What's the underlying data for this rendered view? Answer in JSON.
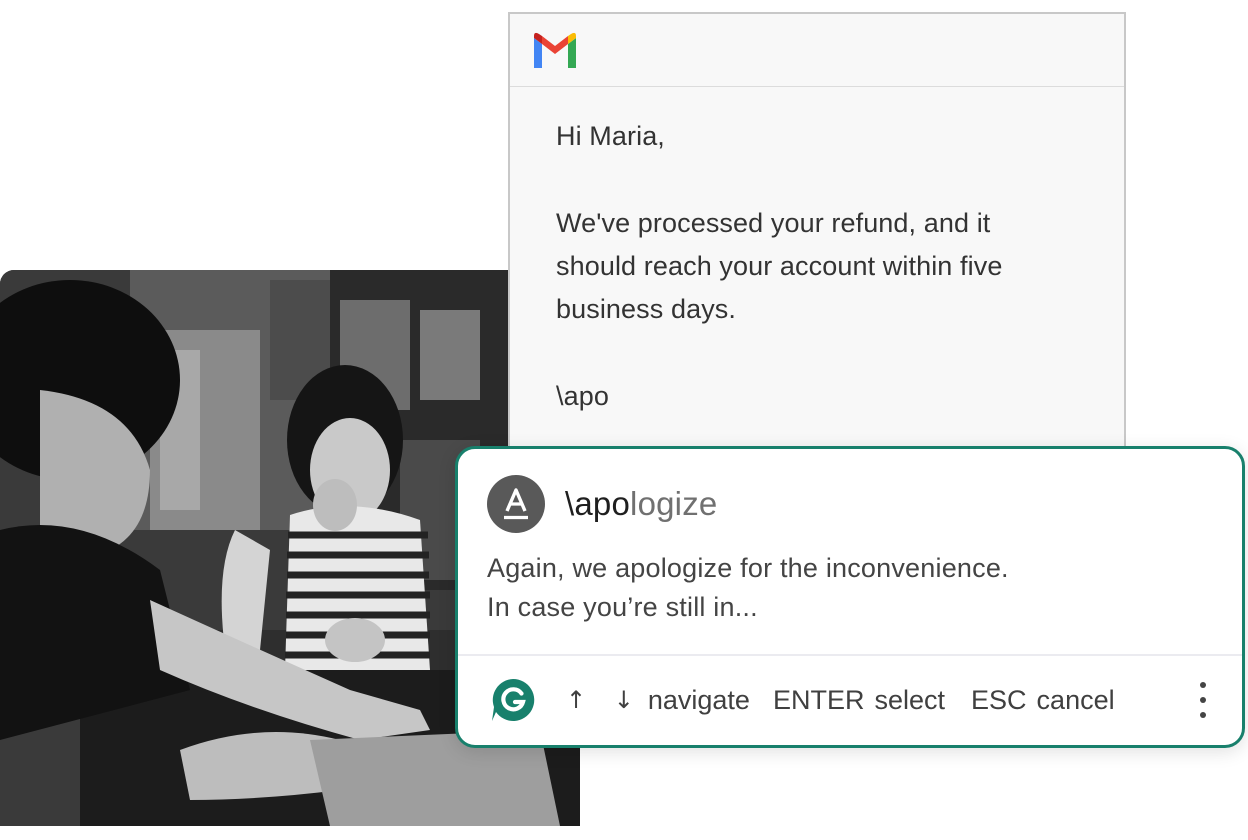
{
  "email": {
    "app_icon": "gmail-icon",
    "greeting": "Hi Maria,",
    "body_lines": [
      "We've processed your refund, and it",
      "should reach your account within five",
      "business days."
    ],
    "typed_text": "\\apo"
  },
  "autocomplete": {
    "avatar_letter": "A",
    "trigger_typed": "\\apo",
    "trigger_rest": "logize",
    "preview_lines": [
      "Again, we apologize for the inconvenience.",
      "In case you’re still in..."
    ],
    "footer": {
      "logo_icon": "grammarly-icon",
      "arrows": "↑ ↓",
      "navigate_label": "navigate",
      "enter_key": "ENTER",
      "enter_label": "select",
      "esc_key": "ESC",
      "esc_label": "cancel",
      "menu_icon": "more-vertical-icon"
    },
    "accent_color": "#18806c"
  }
}
